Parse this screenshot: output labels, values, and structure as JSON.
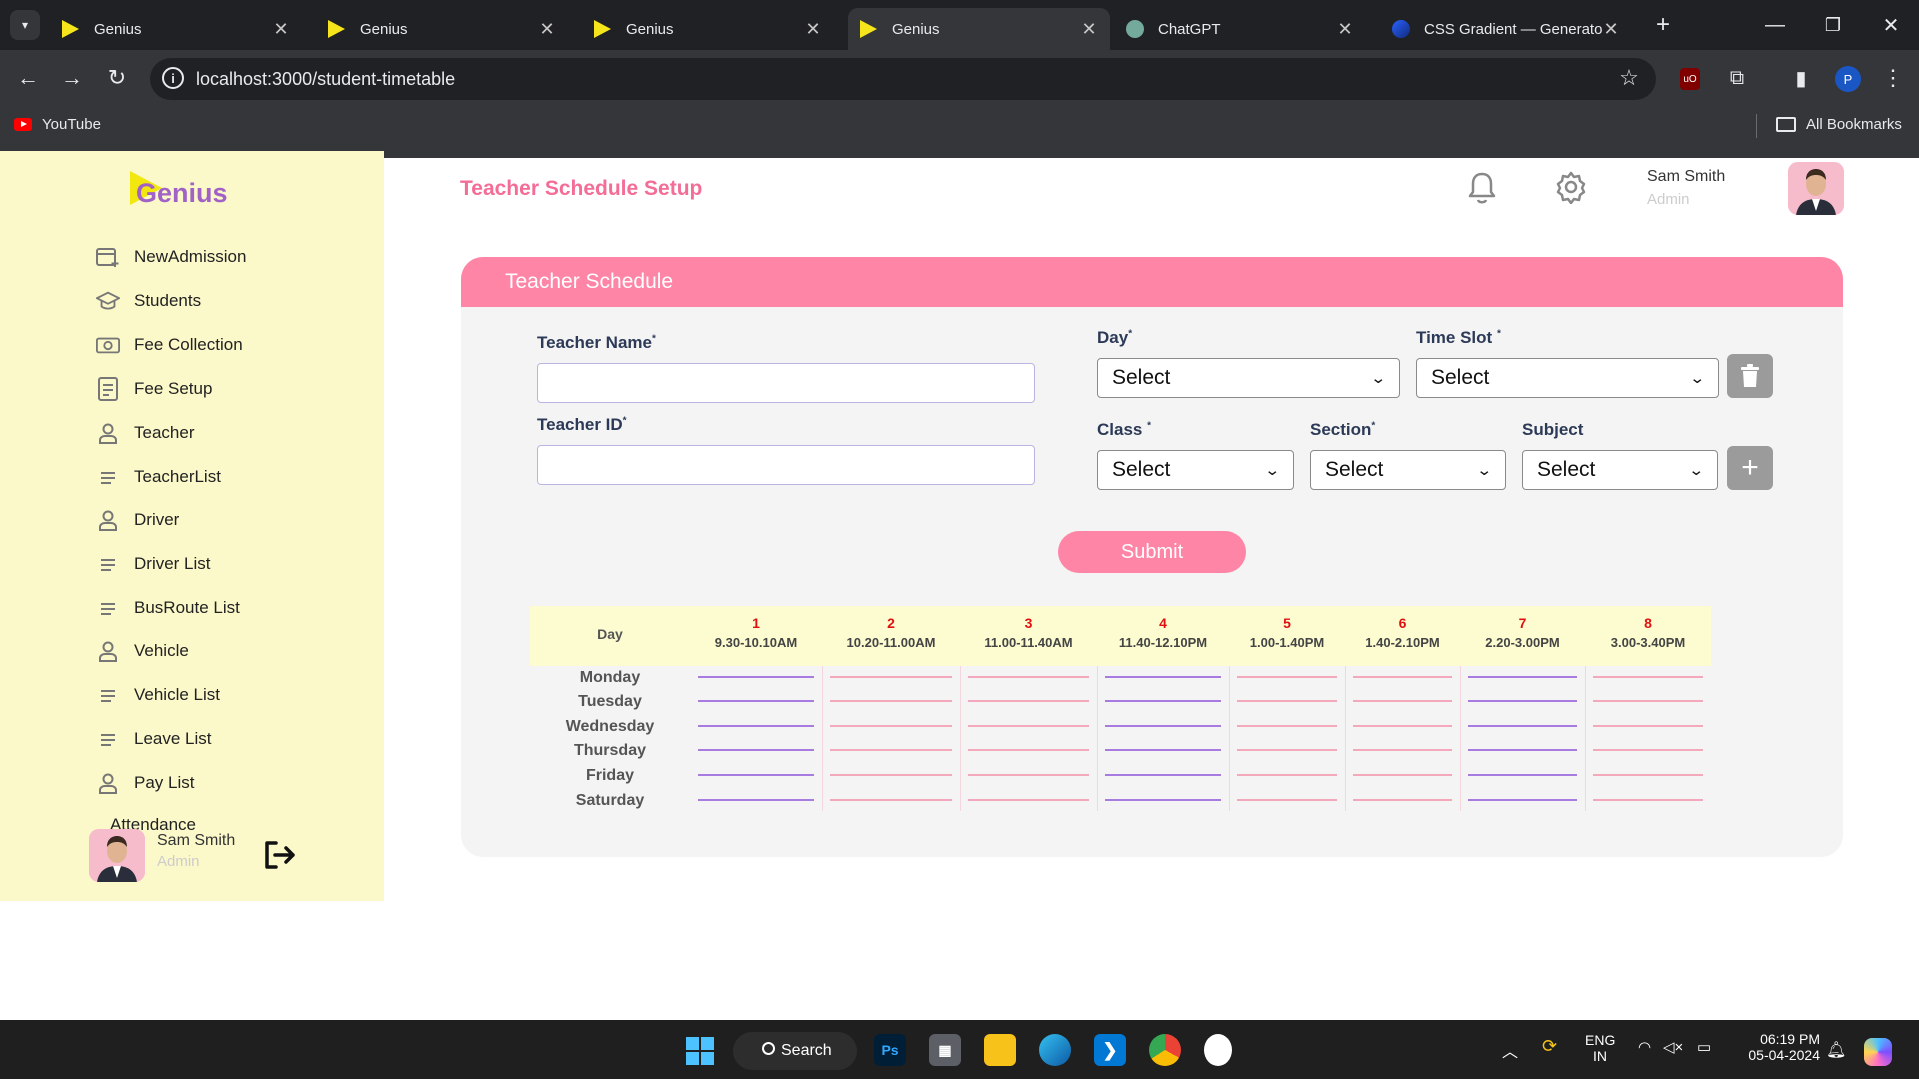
{
  "browser": {
    "tabs": [
      {
        "title": "Genius"
      },
      {
        "title": "Genius"
      },
      {
        "title": "Genius"
      },
      {
        "title": "Genius"
      },
      {
        "title": "ChatGPT"
      },
      {
        "title": "CSS Gradient — Generator"
      }
    ],
    "url": "localhost:3000/student-timetable",
    "bookmarks": [
      {
        "label": "YouTube"
      }
    ],
    "all_bookmarks_label": "All Bookmarks",
    "profile_initial": "P"
  },
  "app": {
    "logo": "Genius",
    "nav": [
      {
        "label": "NewAdmission",
        "icon": "calendar-add-icon"
      },
      {
        "label": "Students",
        "icon": "graduation-cap-icon"
      },
      {
        "label": "Fee Collection",
        "icon": "money-icon"
      },
      {
        "label": "Fee Setup",
        "icon": "document-icon"
      },
      {
        "label": "Teacher",
        "icon": "person-icon"
      },
      {
        "label": "TeacherList",
        "icon": "list-icon"
      },
      {
        "label": "Driver",
        "icon": "person-icon"
      },
      {
        "label": "Driver List",
        "icon": "list-icon"
      },
      {
        "label": "BusRoute List",
        "icon": "list-icon"
      },
      {
        "label": "Vehicle",
        "icon": "person-icon"
      },
      {
        "label": "Vehicle List",
        "icon": "list-icon"
      },
      {
        "label": "Leave List",
        "icon": "list-icon"
      },
      {
        "label": "Pay List",
        "icon": "person-icon"
      },
      {
        "label": "Attendance",
        "icon": "person-icon"
      }
    ],
    "sidebar_user": {
      "name": "Sam Smith",
      "role": "Admin"
    },
    "header": {
      "title": "Teacher Schedule Setup",
      "user_name": "Sam Smith",
      "user_role": "Admin"
    },
    "card_title": "Teacher Schedule",
    "form": {
      "teacher_name_label": "Teacher Name",
      "teacher_name_value": "",
      "teacher_id_label": "Teacher ID",
      "teacher_id_value": "",
      "day_label": "Day",
      "day_value": "Select",
      "time_slot_label": "Time Slot",
      "time_slot_value": "Select",
      "class_label": "Class",
      "class_value": "Select",
      "section_label": "Section",
      "section_value": "Select",
      "subject_label": "Subject",
      "subject_value": "Select",
      "required_mark": "*",
      "submit_label": "Submit"
    },
    "timetable": {
      "day_header": "Day",
      "periods": [
        {
          "num": "1",
          "time": "9.30-10.10AM"
        },
        {
          "num": "2",
          "time": "10.20-11.00AM"
        },
        {
          "num": "3",
          "time": "11.00-11.40AM"
        },
        {
          "num": "4",
          "time": "11.40-12.10PM"
        },
        {
          "num": "5",
          "time": "1.00-1.40PM"
        },
        {
          "num": "6",
          "time": "1.40-2.10PM"
        },
        {
          "num": "7",
          "time": "2.20-3.00PM"
        },
        {
          "num": "8",
          "time": "3.00-3.40PM"
        }
      ],
      "days": [
        "Monday",
        "Tuesday",
        "Wednesday",
        "Thursday",
        "Friday",
        "Saturday"
      ]
    },
    "colors": {
      "accent_pink": "#ff85a6",
      "title_pink": "#f36d97",
      "sidebar_bg": "#fbf8c9",
      "slot_purple": "#a77be0",
      "slot_pink": "#f4a8bb"
    }
  },
  "taskbar": {
    "search_label": "Search",
    "lang": "ENG",
    "region": "IN",
    "time": "06:19 PM",
    "date": "05-04-2024"
  }
}
